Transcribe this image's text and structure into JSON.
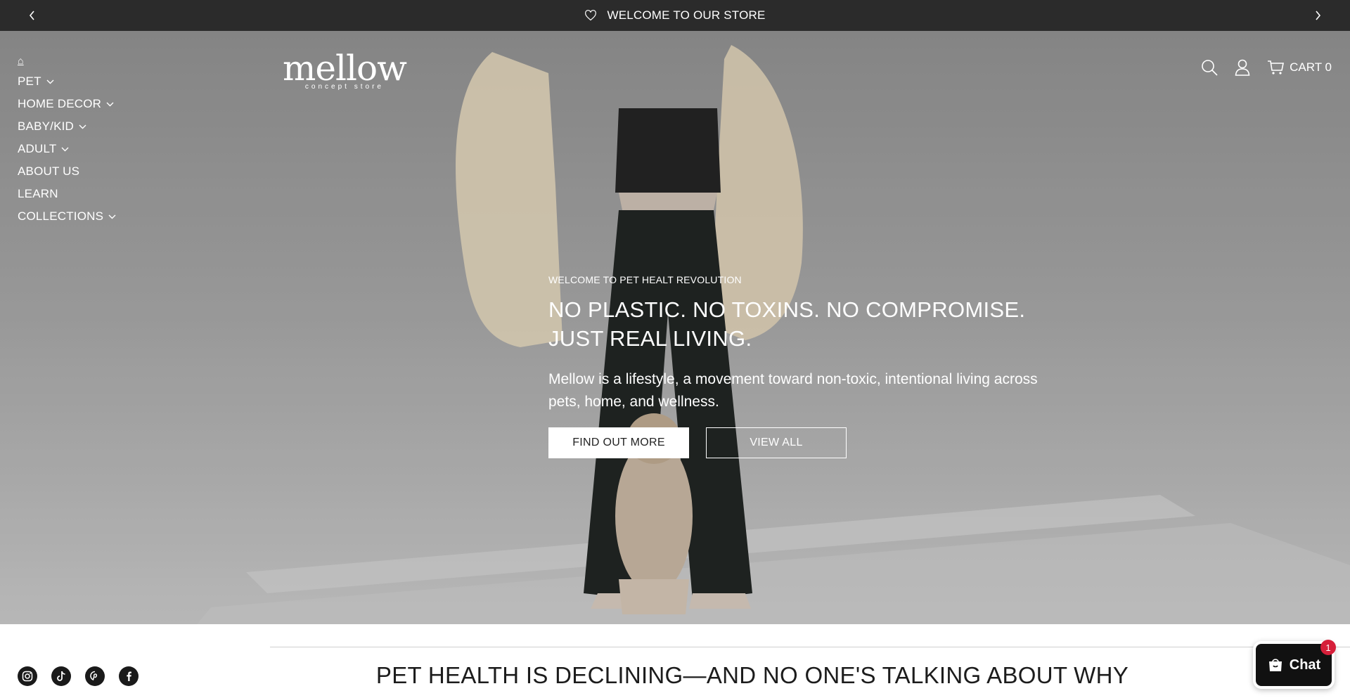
{
  "announcement": {
    "text": "WELCOME TO OUR STORE"
  },
  "brand": {
    "name": "mellow",
    "tagline": "concept store"
  },
  "nav": {
    "home_glyph": "⌂",
    "items": [
      {
        "label": "PET",
        "has_dropdown": true
      },
      {
        "label": "HOME DECOR",
        "has_dropdown": true
      },
      {
        "label": "BABY/KID",
        "has_dropdown": true
      },
      {
        "label": "ADULT",
        "has_dropdown": true
      },
      {
        "label": "ABOUT US",
        "has_dropdown": false
      },
      {
        "label": "LEARN",
        "has_dropdown": false
      },
      {
        "label": "COLLECTIONS",
        "has_dropdown": true
      }
    ]
  },
  "header": {
    "cart_label": "CART 0"
  },
  "hero": {
    "eyebrow": "WELCOME TO PET HEALT REVOLUTION",
    "title": "NO PLASTIC. NO TOXINS. NO COMPROMISE. JUST REAL LIVING.",
    "description": "Mellow is a lifestyle, a movement toward non-toxic, intentional living across pets, home, and wellness.",
    "primary_button": "FIND OUT MORE",
    "secondary_button": "VIEW ALL"
  },
  "section": {
    "title": "PET HEALTH IS DECLINING—AND NO ONE'S TALKING ABOUT WHY"
  },
  "socials": [
    "instagram-icon",
    "tiktok-icon",
    "pinterest-icon",
    "facebook-icon"
  ],
  "chat": {
    "label": "Chat",
    "badge": "1"
  },
  "colors": {
    "announcement_bg": "#2b2b2b",
    "chat_bg": "#111111",
    "badge": "#d61f3a"
  }
}
